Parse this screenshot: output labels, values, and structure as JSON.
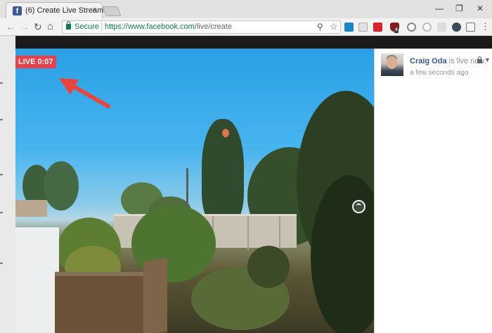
{
  "browser": {
    "tab": {
      "favicon": "f",
      "title": "(6) Create Live Stream",
      "close": "×",
      "favicon_color": "#3b5998"
    },
    "window_controls": {
      "minimize": "—",
      "restore": "❐",
      "close": "✕"
    },
    "toolbar": {
      "back_icon": "←",
      "forward_icon": "→",
      "reload_icon": "↻",
      "home_icon": "⌂",
      "secure_label": "Secure",
      "url_scheme_host": "https://www.facebook.com",
      "url_path": "/live/create",
      "zoom_icon": "⚲",
      "star_icon": "☆",
      "extension_icons": [
        "trello-icon",
        "shield-icon",
        "red-book-icon",
        "ublock-icon",
        "pocket-icon",
        "circle-icon",
        "bracket-icon",
        "gear-icon",
        "react-icon",
        "checkbox-icon",
        "honey-icon"
      ],
      "extension_badge": "4",
      "menu_icon": "⋮"
    }
  },
  "video": {
    "live_badge": "LIVE 0:07",
    "badge_color": "#e9404a",
    "annotation_arrow_color": "#e8453c"
  },
  "sidebar": {
    "poster_name": "Craig Oda",
    "status": " is live now.",
    "timestamp": "a few seconds ago",
    "name_color": "#365899"
  }
}
